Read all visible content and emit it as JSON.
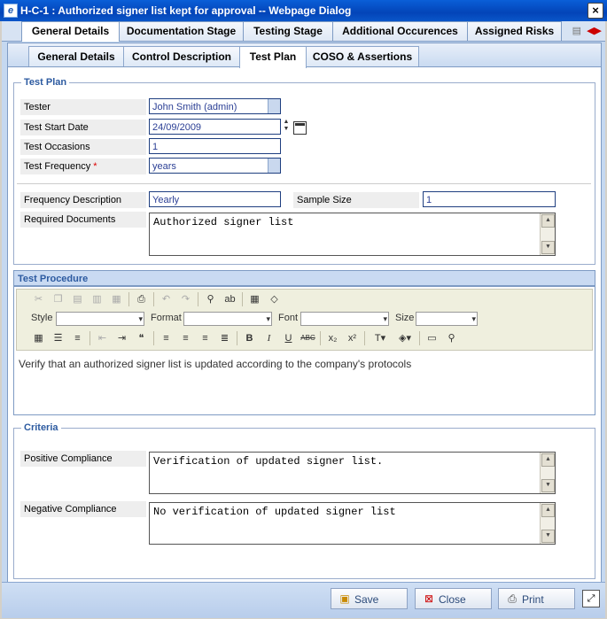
{
  "window": {
    "title": "H-C-1 : Authorized signer list kept for approval -- Webpage Dialog",
    "close": "×"
  },
  "top_tabs": [
    "General Details",
    "Documentation Stage",
    "Testing Stage",
    "Additional Occurences",
    "Assigned Risks"
  ],
  "sub_tabs": [
    "General Details",
    "Control Description",
    "Test Plan",
    "COSO & Assertions"
  ],
  "test_plan": {
    "legend": "Test Plan",
    "tester_label": "Tester",
    "tester_value": "John Smith (admin)",
    "start_date_label": "Test Start Date",
    "start_date_value": "24/09/2009",
    "occasions_label": "Test Occasions",
    "occasions_value": "1",
    "frequency_label": "Test Frequency",
    "required_mark": "*",
    "frequency_value": "years",
    "freq_desc_label": "Frequency Description",
    "freq_desc_value": "Yearly",
    "sample_size_label": "Sample Size",
    "sample_size_value": "1",
    "required_docs_label": "Required Documents",
    "required_docs_value": "Authorized signer list"
  },
  "test_procedure": {
    "heading": "Test Procedure",
    "style_label": "Style",
    "format_label": "Format",
    "font_label": "Font",
    "size_label": "Size",
    "content": "Verify that an authorized signer list is updated according to the company's protocols"
  },
  "criteria": {
    "legend": "Criteria",
    "positive_label": "Positive Compliance",
    "positive_value": "Verification of updated signer list.",
    "negative_label": "Negative Compliance",
    "negative_value": "No verification of updated signer list"
  },
  "footer": {
    "save": "Save",
    "close": "Close",
    "print": "Print"
  }
}
